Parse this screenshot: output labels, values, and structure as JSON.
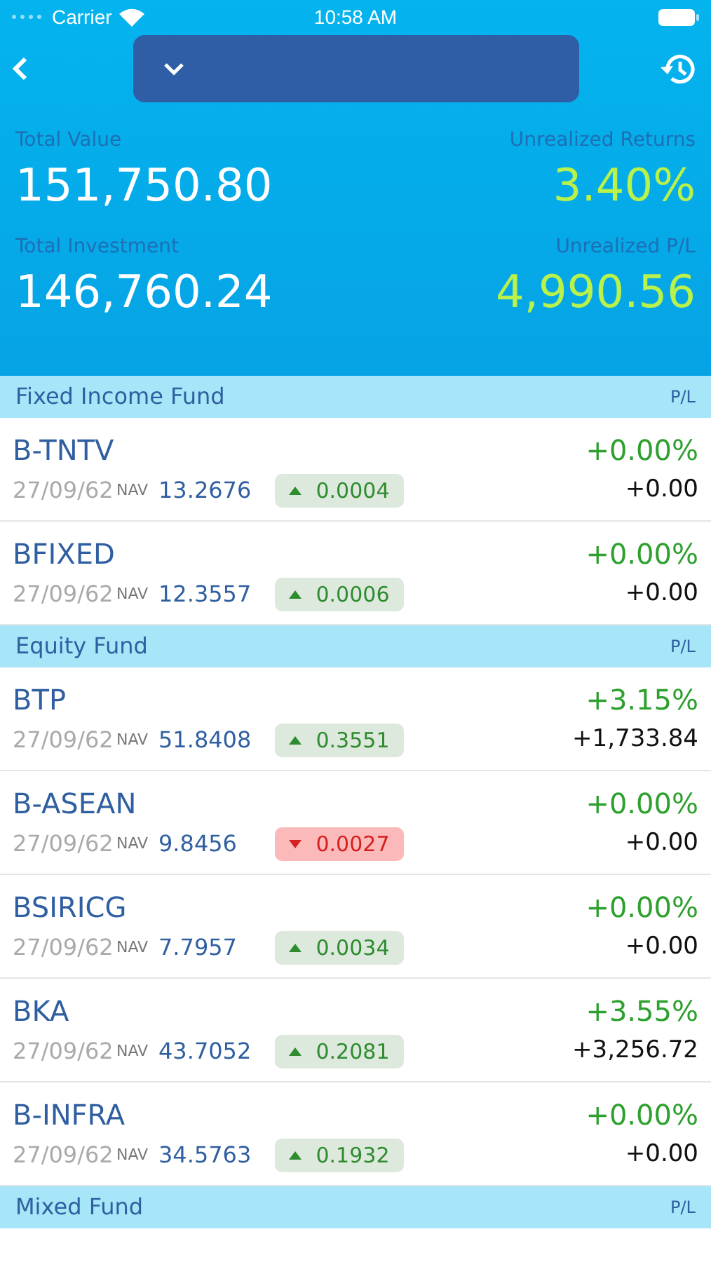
{
  "status_bar": {
    "carrier": "Carrier",
    "time": "10:58 AM"
  },
  "summary": [
    {
      "label": "Total Value",
      "value": "151,750.80",
      "kind": "total"
    },
    {
      "label": "Unrealized Returns",
      "value": "3.40%",
      "kind": "gain"
    },
    {
      "label": "Total Investment",
      "value": "146,760.24",
      "kind": "total"
    },
    {
      "label": "Unrealized P/L",
      "value": "4,990.56",
      "kind": "gain"
    }
  ],
  "sections": [
    {
      "title": "Fixed Income Fund",
      "column": "P/L",
      "funds": [
        {
          "name": "B-TNTV",
          "date": "27/09/62",
          "nav_label": "NAV",
          "nav": "13.2676",
          "change": "0.0004",
          "kind": "up",
          "percent": "+0.00%",
          "pl": "+0.00"
        },
        {
          "name": "BFIXED",
          "date": "27/09/62",
          "nav_label": "NAV",
          "nav": "12.3557",
          "change": "0.0006",
          "kind": "up",
          "percent": "+0.00%",
          "pl": "+0.00"
        }
      ]
    },
    {
      "title": "Equity Fund",
      "column": "P/L",
      "funds": [
        {
          "name": "BTP",
          "date": "27/09/62",
          "nav_label": "NAV",
          "nav": "51.8408",
          "change": "0.3551",
          "kind": "up",
          "percent": "+3.15%",
          "pl": "+1,733.84"
        },
        {
          "name": "B-ASEAN",
          "date": "27/09/62",
          "nav_label": "NAV",
          "nav": "9.8456",
          "change": "0.0027",
          "kind": "down",
          "percent": "+0.00%",
          "pl": "+0.00"
        },
        {
          "name": "BSIRICG",
          "date": "27/09/62",
          "nav_label": "NAV",
          "nav": "7.7957",
          "change": "0.0034",
          "kind": "up",
          "percent": "+0.00%",
          "pl": "+0.00"
        },
        {
          "name": "BKA",
          "date": "27/09/62",
          "nav_label": "NAV",
          "nav": "43.7052",
          "change": "0.2081",
          "kind": "up",
          "percent": "+3.55%",
          "pl": "+3,256.72"
        },
        {
          "name": "B-INFRA",
          "date": "27/09/62",
          "nav_label": "NAV",
          "nav": "34.5763",
          "change": "0.1932",
          "kind": "up",
          "percent": "+0.00%",
          "pl": "+0.00"
        }
      ]
    },
    {
      "title": "Mixed Fund",
      "column": "P/L"
    }
  ]
}
